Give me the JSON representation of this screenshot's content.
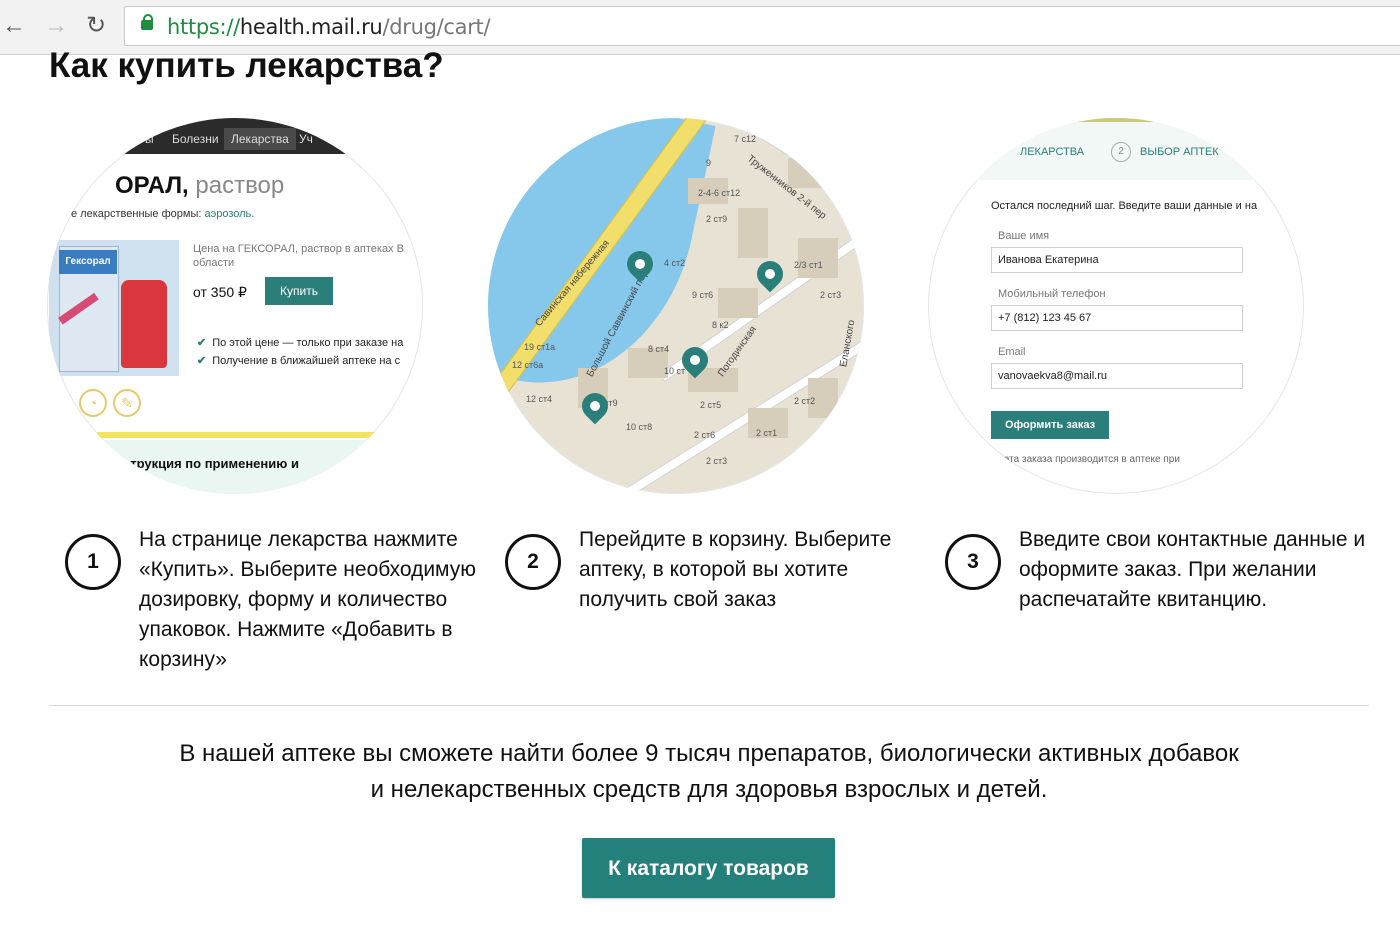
{
  "browser": {
    "back_icon": "←",
    "forward_icon": "→",
    "reload_icon": "↻",
    "url_scheme": "https://",
    "url_host": "health.mail.ru",
    "url_path": "/drug/cart/"
  },
  "page": {
    "title": "Как купить лекарства?"
  },
  "illustration1": {
    "menu_items": [
      "Болезни",
      "Лекарства",
      "Уч"
    ],
    "menu_partial_left": "ы",
    "drug_name": "ГЕКСОРАЛ,",
    "drug_name_left": "ОРАЛ,",
    "drug_form": "раствор",
    "forms_label": "е лекарственные формы:",
    "forms_link": "аэрозоль.",
    "pack_brand": "Гексорал",
    "price_caption": "Цена на ГЕКСОРАЛ, раствор в аптеках В области",
    "price": "от 350 ₽",
    "buy_label": "Купить",
    "check1": "По этой цене — только при заказе на",
    "check2": "Получение в ближайшей аптеке на с",
    "instructions": "струкция по применению и"
  },
  "illustration2": {
    "streets": [
      "Савинская набережная",
      "Большой Саввинский пер",
      "Погодинская",
      "Труженников 2-й пер",
      "Еланского"
    ],
    "numbers": [
      "7 с12",
      "9",
      "2-4-6 ст12",
      "2 ст9",
      "4 ст2",
      "9 ст6",
      "8 к2",
      "8 ст4",
      "10 ст",
      "2 ст5",
      "2 ст6",
      "2 ст3",
      "2/3 ст1",
      "2 ст3",
      "2 ст2",
      "2 ст1",
      "19 ст1а",
      "12 ст6а",
      "12 ст4",
      "ст9",
      "10 ст8"
    ]
  },
  "illustration3": {
    "step1": "ЛЕКАРСТВА",
    "step2_num": "2",
    "step2": "ВЫБОР АПТЕК",
    "hint": "Остался последний шаг. Введите ваши данные и на",
    "name_label": "Ваше имя",
    "name_value": "Иванова Екатерина",
    "phone_label": "Мобильный телефон",
    "phone_value": "+7 (812) 123 45 67",
    "email_label": "Email",
    "email_value": "vanovaekva8@mail.ru",
    "order_label": "Оформить заказ",
    "footnote": "лата заказа производится в аптеке при"
  },
  "steps": [
    {
      "num": "1",
      "text": "На странице лекарства нажмите «Купить». Выберите необходимую дозировку, форму и количество упаковок. Нажмите «Добавить в корзину»"
    },
    {
      "num": "2",
      "text": "Перейдите в корзину. Выберите аптеку, в которой вы хотите получить свой заказ"
    },
    {
      "num": "3",
      "text": "Введите свои контактные данные и оформите заказ. При желании распечатайте квитанцию."
    }
  ],
  "promo": {
    "line1": "В нашей аптеке вы сможете найти более 9 тысяч препаратов, биологически активных добавок",
    "line2": "и нелекарственных средств для здоровья взрослых и детей."
  },
  "catalog_button": "К каталогу товаров",
  "colors": {
    "accent": "#24807a",
    "water": "#86c7ec",
    "road": "#f2df6b"
  }
}
